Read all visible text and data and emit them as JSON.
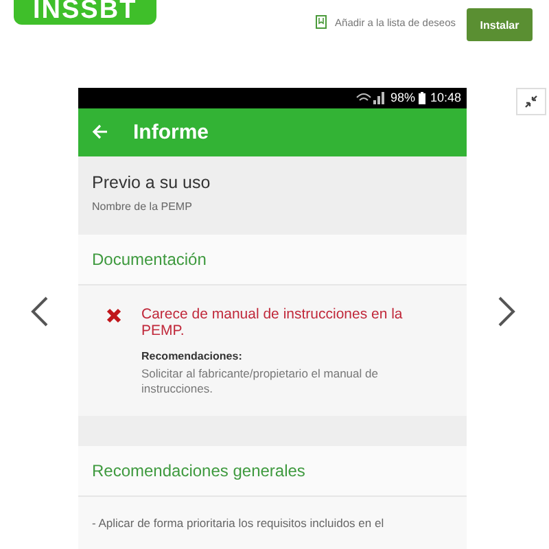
{
  "logo": "INSSBT",
  "header": {
    "wishlist": "Añadir a la lista de deseos",
    "install": "Instalar"
  },
  "status_bar": {
    "battery": "98%",
    "time": "10:48"
  },
  "app_bar": {
    "title": "Informe"
  },
  "section": {
    "title": "Previo a su uso",
    "subtitle": "Nombre de la PEMP"
  },
  "groups": [
    {
      "title": "Documentación",
      "items": [
        {
          "kind": "fail",
          "issue": "Carece de manual de instrucciones en la PEMP.",
          "label": "Recomendaciones:",
          "text": "Solicitar al fabricante/propietario el manual de instrucciones."
        }
      ]
    },
    {
      "title": "Recomendaciones generales",
      "note": "- Aplicar de forma prioritaria los requisitos incluidos en el"
    }
  ]
}
